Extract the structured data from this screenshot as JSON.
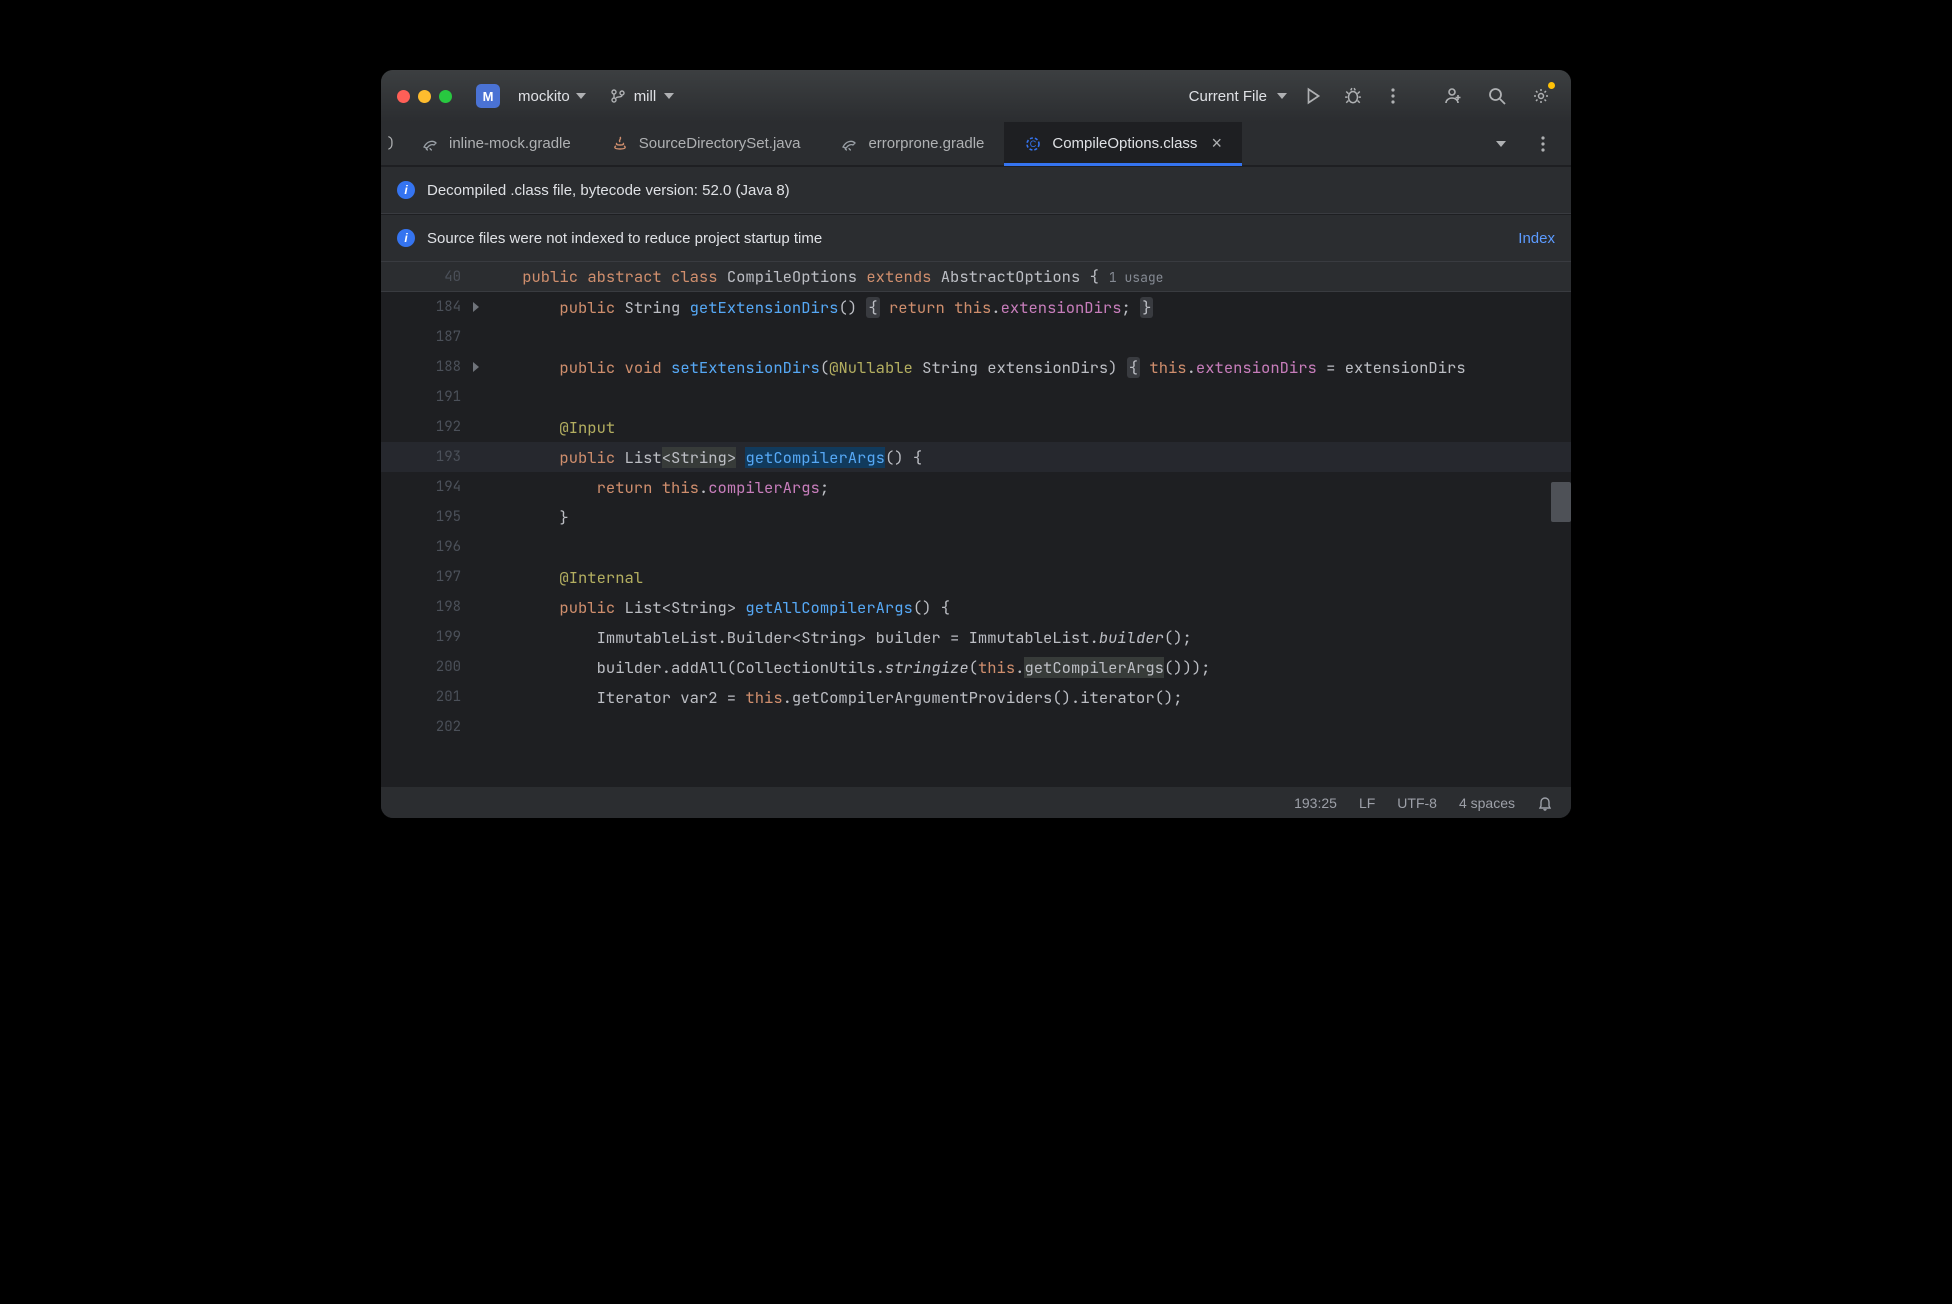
{
  "titlebar": {
    "project_badge": "M",
    "project_name": "mockito",
    "branch": "mill",
    "run_config": "Current File"
  },
  "tabs": [
    {
      "label": "inline-mock.gradle",
      "type": "gradle"
    },
    {
      "label": "SourceDirectorySet.java",
      "type": "java"
    },
    {
      "label": "errorprone.gradle",
      "type": "gradle"
    },
    {
      "label": "CompileOptions.class",
      "type": "class",
      "active": true,
      "closeable": true
    }
  ],
  "banners": {
    "decompiled": "Decompiled .class file, bytecode version: 52.0 (Java 8)",
    "indexing": "Source files were not indexed to reduce project startup time",
    "index_link": "Index"
  },
  "editor": {
    "sticky": {
      "lineno": "40",
      "tokens": [
        {
          "t": "    ",
          "c": ""
        },
        {
          "t": "public ",
          "c": "kw"
        },
        {
          "t": "abstract ",
          "c": "kw"
        },
        {
          "t": "class ",
          "c": "kw"
        },
        {
          "t": "CompileOptions ",
          "c": "type"
        },
        {
          "t": "extends ",
          "c": "kw"
        },
        {
          "t": "AbstractOptions ",
          "c": "type"
        },
        {
          "t": "{",
          "c": ""
        }
      ],
      "inlay": "1 usage"
    },
    "lines": [
      {
        "lineno": "184",
        "fold": true,
        "tokens": [
          {
            "t": "        ",
            "c": ""
          },
          {
            "t": "public ",
            "c": "kw"
          },
          {
            "t": "String ",
            "c": "type"
          },
          {
            "t": "getExtensionDirs",
            "c": "method"
          },
          {
            "t": "() ",
            "c": ""
          },
          {
            "t": "{",
            "c": "fold-brace"
          },
          {
            "t": " ",
            "c": ""
          },
          {
            "t": "return ",
            "c": "kw"
          },
          {
            "t": "this",
            "c": "kw"
          },
          {
            "t": ".",
            "c": ""
          },
          {
            "t": "extensionDirs",
            "c": "field"
          },
          {
            "t": "; ",
            "c": ""
          },
          {
            "t": "}",
            "c": "fold-brace"
          }
        ]
      },
      {
        "lineno": "187",
        "tokens": []
      },
      {
        "lineno": "188",
        "fold": true,
        "tokens": [
          {
            "t": "        ",
            "c": ""
          },
          {
            "t": "public ",
            "c": "kw"
          },
          {
            "t": "void ",
            "c": "kw"
          },
          {
            "t": "setExtensionDirs",
            "c": "method"
          },
          {
            "t": "(",
            "c": ""
          },
          {
            "t": "@Nullable ",
            "c": "anno"
          },
          {
            "t": "String extensionDirs) ",
            "c": "param"
          },
          {
            "t": "{",
            "c": "fold-brace"
          },
          {
            "t": " ",
            "c": ""
          },
          {
            "t": "this",
            "c": "kw"
          },
          {
            "t": ".",
            "c": ""
          },
          {
            "t": "extensionDirs",
            "c": "field"
          },
          {
            "t": " = extensionDirs",
            "c": ""
          }
        ]
      },
      {
        "lineno": "191",
        "tokens": []
      },
      {
        "lineno": "192",
        "tokens": [
          {
            "t": "        ",
            "c": ""
          },
          {
            "t": "@Input",
            "c": "anno"
          }
        ]
      },
      {
        "lineno": "193",
        "caret": true,
        "tokens": [
          {
            "t": "        ",
            "c": ""
          },
          {
            "t": "public ",
            "c": "kw"
          },
          {
            "t": "List",
            "c": "type"
          },
          {
            "t": "<String>",
            "c": "hl-usage"
          },
          {
            "t": " ",
            "c": ""
          },
          {
            "t": "getCompilerArgs",
            "c": "method hl-decl"
          },
          {
            "t": "() {",
            "c": ""
          }
        ]
      },
      {
        "lineno": "194",
        "tokens": [
          {
            "t": "            ",
            "c": ""
          },
          {
            "t": "return ",
            "c": "kw"
          },
          {
            "t": "this",
            "c": "kw"
          },
          {
            "t": ".",
            "c": ""
          },
          {
            "t": "compilerArgs",
            "c": "field"
          },
          {
            "t": ";",
            "c": ""
          }
        ]
      },
      {
        "lineno": "195",
        "tokens": [
          {
            "t": "        ",
            "c": ""
          },
          {
            "t": "}",
            "c": ""
          }
        ]
      },
      {
        "lineno": "196",
        "tokens": []
      },
      {
        "lineno": "197",
        "tokens": [
          {
            "t": "        ",
            "c": ""
          },
          {
            "t": "@Internal",
            "c": "anno"
          }
        ]
      },
      {
        "lineno": "198",
        "tokens": [
          {
            "t": "        ",
            "c": ""
          },
          {
            "t": "public ",
            "c": "kw"
          },
          {
            "t": "List<String> ",
            "c": "type"
          },
          {
            "t": "getAllCompilerArgs",
            "c": "method"
          },
          {
            "t": "() {",
            "c": ""
          }
        ]
      },
      {
        "lineno": "199",
        "tokens": [
          {
            "t": "            ",
            "c": ""
          },
          {
            "t": "ImmutableList.Builder<String> builder = ImmutableList.",
            "c": ""
          },
          {
            "t": "builder",
            "c": "method-static"
          },
          {
            "t": "();",
            "c": ""
          }
        ]
      },
      {
        "lineno": "200",
        "tokens": [
          {
            "t": "            ",
            "c": ""
          },
          {
            "t": "builder.addAll(CollectionUtils.",
            "c": ""
          },
          {
            "t": "stringize",
            "c": "method-static"
          },
          {
            "t": "(",
            "c": ""
          },
          {
            "t": "this",
            "c": "kw"
          },
          {
            "t": ".",
            "c": ""
          },
          {
            "t": "getCompilerArgs",
            "c": "hl-usage"
          },
          {
            "t": "()));",
            "c": ""
          }
        ]
      },
      {
        "lineno": "201",
        "tokens": [
          {
            "t": "            ",
            "c": ""
          },
          {
            "t": "Iterator var2 = ",
            "c": ""
          },
          {
            "t": "this",
            "c": "kw"
          },
          {
            "t": ".getCompilerArgumentProviders().iterator();",
            "c": ""
          }
        ]
      },
      {
        "lineno": "202",
        "tokens": []
      }
    ]
  },
  "statusbar": {
    "pos": "193:25",
    "line_sep": "LF",
    "encoding": "UTF-8",
    "indent": "4 spaces"
  }
}
